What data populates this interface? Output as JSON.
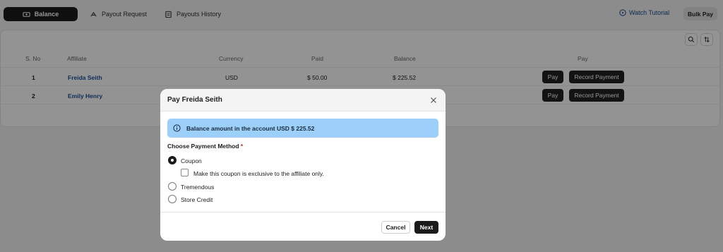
{
  "tabs": [
    {
      "label": "Balance",
      "icon": "balance-icon"
    },
    {
      "label": "Payout Request",
      "icon": "payout-request-icon"
    },
    {
      "label": "Payouts History",
      "icon": "history-icon"
    }
  ],
  "header": {
    "watch_tutorial": "Watch Tutorial",
    "bulk_pay": "Bulk Pay"
  },
  "table": {
    "columns": [
      "S. No",
      "Affiliate",
      "Currency",
      "Paid",
      "Balance",
      "Pay"
    ],
    "rows": [
      {
        "sno": "1",
        "affiliate": "Freida Seith",
        "currency": "USD",
        "paid": "$ 50.00",
        "balance": "$ 225.52",
        "pay": "Pay",
        "record": "Record Payment"
      },
      {
        "sno": "2",
        "affiliate": "Emily Henry",
        "currency": "",
        "paid": "",
        "balance": "",
        "pay": "Pay",
        "record": "Record Payment"
      }
    ]
  },
  "modal": {
    "title": "Pay Freida Seith",
    "alert": "Balance amount in the account USD $ 225.52",
    "method_label": "Choose Payment Method",
    "required_mark": "*",
    "options": [
      {
        "label": "Coupon",
        "selected": true
      },
      {
        "label": "Tremendous",
        "selected": false
      },
      {
        "label": "Store Credit",
        "selected": false
      }
    ],
    "coupon_checkbox": "Make this coupon is exclusive to the affiliate only.",
    "cancel": "Cancel",
    "next": "Next"
  },
  "colors": {
    "accent": "#1a1a1a",
    "link": "#1d4f9a",
    "alert_bg": "#9dcffb",
    "required": "#d42424"
  }
}
